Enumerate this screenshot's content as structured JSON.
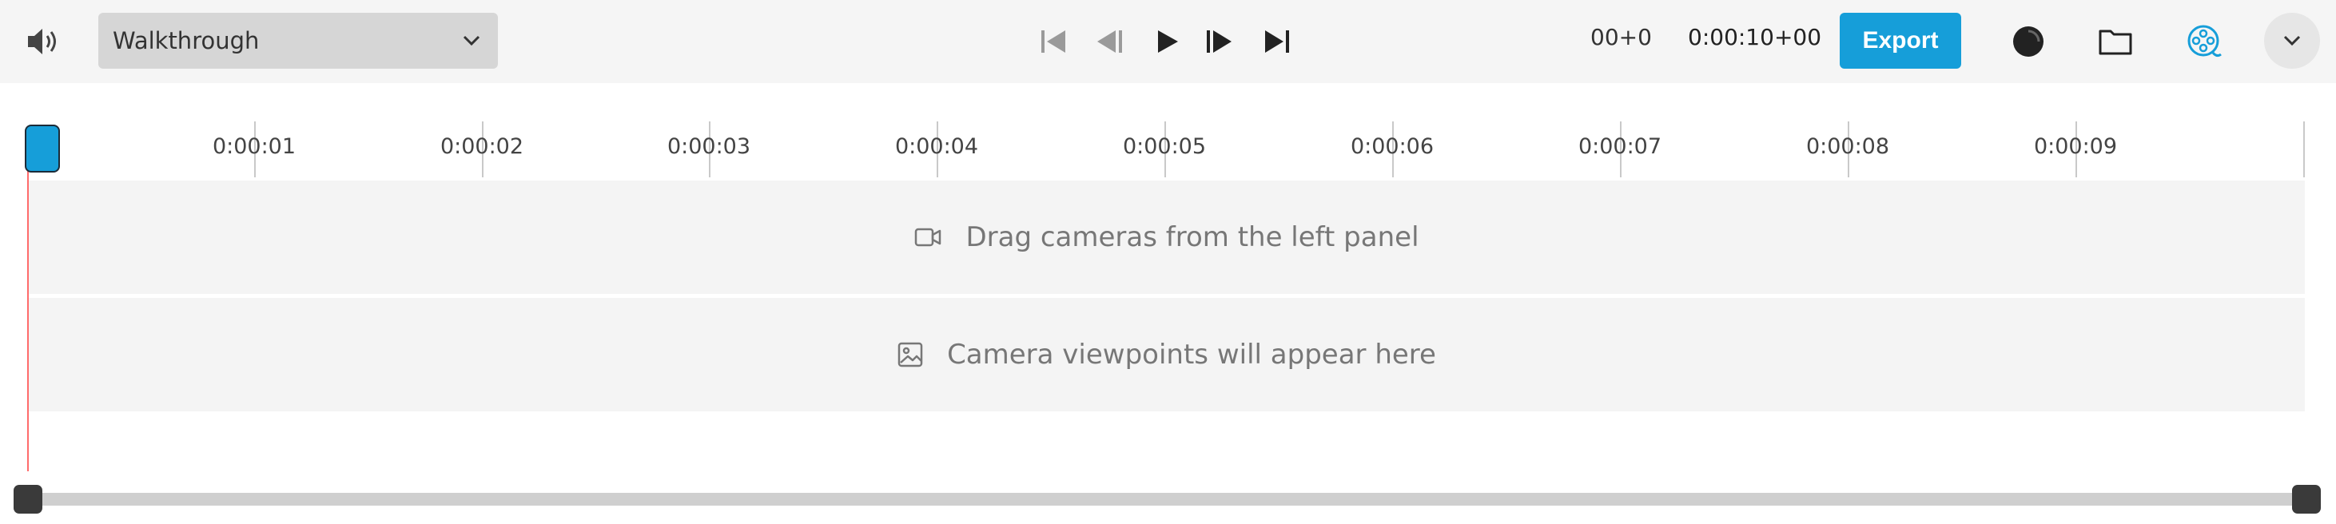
{
  "toolbar": {
    "sequence_select": {
      "value": "Walkthrough"
    },
    "timecode": {
      "frames": "00+0",
      "total": "0:00:10+00"
    },
    "export_label": "Export",
    "icons": {
      "volume": "speaker-volume-icon",
      "skip_start": "skip-to-start-icon",
      "step_back": "step-backward-icon",
      "play": "play-icon",
      "step_forward": "step-forward-icon",
      "skip_end": "skip-to-end-icon",
      "record": "record-dot-icon",
      "folder": "folder-icon",
      "film": "film-reel-icon",
      "menu": "chevron-down-icon"
    },
    "colors": {
      "accent": "#169ed9",
      "toolbar_bg": "#f5f5f5"
    }
  },
  "timeline": {
    "ticks": [
      "0:00:01",
      "0:00:02",
      "0:00:03",
      "0:00:04",
      "0:00:05",
      "0:00:06",
      "0:00:07",
      "0:00:08",
      "0:00:09"
    ],
    "playhead_color": "#ff6b6b"
  },
  "tracks": {
    "cameras_placeholder": "Drag cameras from the left panel",
    "viewpoints_placeholder": "Camera viewpoints will appear here"
  }
}
